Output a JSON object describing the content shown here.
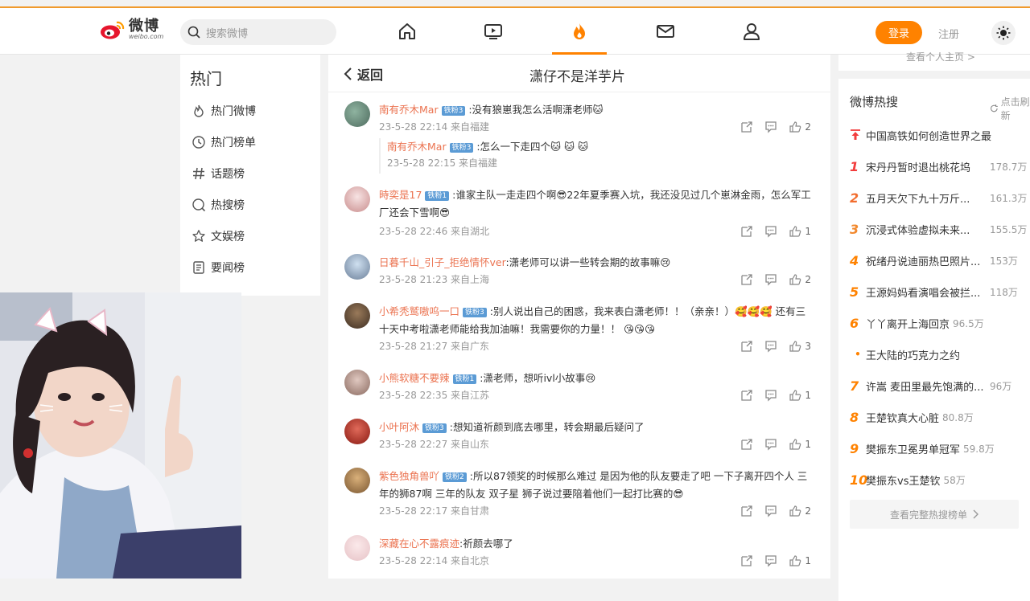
{
  "header": {
    "logo_cn": "微博",
    "logo_en": "weibo.com",
    "search_placeholder": "搜索微博",
    "login": "登录",
    "register": "注册",
    "accent": "#ff8200"
  },
  "nav": [
    {
      "icon": "home-icon"
    },
    {
      "icon": "video-icon"
    },
    {
      "icon": "hot-flame-icon",
      "active": true
    },
    {
      "icon": "mail-icon"
    },
    {
      "icon": "user-icon"
    }
  ],
  "left": {
    "title": "热门",
    "items": [
      {
        "label": "热门微博",
        "icon": "flame-outline-icon"
      },
      {
        "label": "热门榜单",
        "icon": "clock-icon"
      },
      {
        "label": "话题榜",
        "icon": "hashtag-icon"
      },
      {
        "label": "热搜榜",
        "icon": "search-circle-icon"
      },
      {
        "label": "文娱榜",
        "icon": "star-icon"
      },
      {
        "label": "要闻榜",
        "icon": "news-icon"
      }
    ]
  },
  "main": {
    "back": "返回",
    "title": "潇仔不是洋芋片",
    "comments": [
      {
        "user": "南有乔木Mar",
        "badge": "铁粉3",
        "text": ":没有狼崽我怎么活啊潇老师🐱",
        "meta": "23-5-28 22:14 来自福建",
        "likes": "2",
        "reply": {
          "user": "南有乔木Mar",
          "badge": "铁粉3",
          "text": ":怎么一下走四个🐱 🐱 🐱",
          "meta": "23-5-28 22:15 来自福建"
        }
      },
      {
        "user": "時奕是17",
        "badge": "铁粉1",
        "text": ":谁家主队一走走四个啊😎22年夏季赛入坑，我还没见过几个崽淋金雨，怎么军工厂还会下雪啊😎",
        "meta": "23-5-28 22:46 来自湖北",
        "likes": "1"
      },
      {
        "user": "日暮千山_引子_拒绝情怀ver",
        "badge": "",
        "text": ":潇老师可以讲一些转会期的故事嘛😢",
        "meta": "23-5-28 21:23 来自上海",
        "likes": "2"
      },
      {
        "user": "小希秃鹫嗷呜一口",
        "badge": "铁粉3",
        "text": ":别人说出自己的困惑，我来表白潇老师！！（亲亲！）🥰🥰🥰 还有三十天中考啦潇老师能给我加油嘛！我需要你的力量！！ 😘😘😘",
        "meta": "23-5-28 21:27 来自广东",
        "likes": "3"
      },
      {
        "user": "小熊软糖不要辣",
        "badge": "铁粉1",
        "text": ":潇老师，想听ivl小故事😢",
        "meta": "23-5-28 22:35 来自江苏",
        "likes": "1"
      },
      {
        "user": "小叶阿沐",
        "badge": "铁粉3",
        "text": ":想知道祈颜到底去哪里，转会期最后疑问了",
        "meta": "23-5-28 22:27 来自山东",
        "likes": "1"
      },
      {
        "user": "紫色独角兽吖",
        "badge": "铁粉2",
        "text": ":所以87领奖的时候那么难过 是因为他的队友要走了吧 一下子离开四个人 三年的狮87啊 三年的队友 双子星 狮子说过要陪着他们一起打比赛的😎",
        "meta": "23-5-28 22:17 来自甘肃",
        "likes": "2"
      },
      {
        "user": "深藏在心不露痕迹",
        "badge": "",
        "text": ":祈颜去哪了",
        "meta": "23-5-28 22:14 来自北京",
        "likes": "1"
      }
    ]
  },
  "right": {
    "top_link": "查看个人主页 >",
    "title": "微博热搜",
    "refresh": "点击刷新",
    "pinned": "中国高铁如何创造世界之最",
    "items": [
      {
        "rank": "1",
        "text": "宋丹丹暂时退出桃花坞",
        "count": "178.7万"
      },
      {
        "rank": "2",
        "text": "五月天欠下九十万斤...",
        "count": "161.3万"
      },
      {
        "rank": "3",
        "text": "沉浸式体验虚拟未来...",
        "count": "155.5万"
      },
      {
        "rank": "4",
        "text": "祝绪丹说迪丽热巴照片...",
        "count": "153万"
      },
      {
        "rank": "5",
        "text": "王源妈妈看演唱会被拦...",
        "count": "118万"
      },
      {
        "rank": "6",
        "text": "丫丫离开上海回京",
        "count": "96.5万"
      },
      {
        "rank": "•",
        "text": "王大陆的巧克力之约",
        "count": ""
      },
      {
        "rank": "7",
        "text": "许嵩 麦田里最先饱满的...",
        "count": "96万"
      },
      {
        "rank": "8",
        "text": "王楚钦真大心脏",
        "count": "80.8万"
      },
      {
        "rank": "9",
        "text": "樊振东卫冕男单冠军",
        "count": "59.8万"
      },
      {
        "rank": "10",
        "text": "樊振东vs王楚钦",
        "count": "58万"
      }
    ],
    "see_more": "查看完整热搜榜单"
  }
}
